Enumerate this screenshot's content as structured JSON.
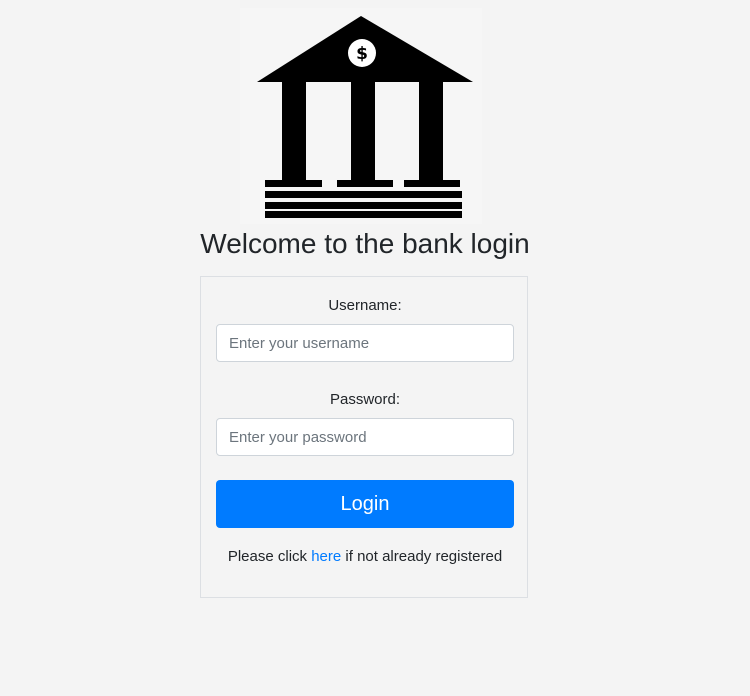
{
  "logo": {
    "icon": "bank-building-icon",
    "symbol": "$",
    "color": "#000000"
  },
  "header": {
    "title": "Welcome to the bank login"
  },
  "form": {
    "username": {
      "label": "Username:",
      "placeholder": "Enter your username",
      "value": ""
    },
    "password": {
      "label": "Password:",
      "placeholder": "Enter your password",
      "value": ""
    },
    "login_label": "Login",
    "register": {
      "prefix": "Please click ",
      "link_text": "here",
      "suffix": " if not already registered"
    }
  },
  "colors": {
    "accent": "#007bff",
    "background": "#f4f4f4",
    "text": "#212529"
  }
}
